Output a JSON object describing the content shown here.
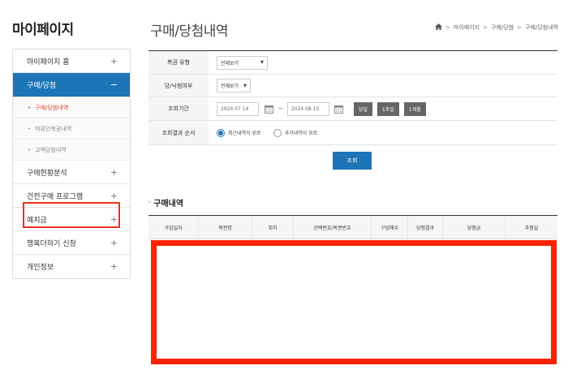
{
  "sidebar": {
    "title": "마이페이지",
    "items": [
      {
        "label": "마이페이지 홈",
        "toggle": "+"
      },
      {
        "label": "구매/당첨",
        "toggle": "−"
      },
      {
        "label": "구매현황분석",
        "toggle": "+"
      },
      {
        "label": "건전구매 프로그램",
        "toggle": "+"
      },
      {
        "label": "예치금",
        "toggle": "+"
      },
      {
        "label": "행복더하기 신청",
        "toggle": "+"
      },
      {
        "label": "개인정보",
        "toggle": "+"
      }
    ],
    "subitems": [
      {
        "label": "구매/당첨내역"
      },
      {
        "label": "미확인복권내역"
      },
      {
        "label": "고액당첨내역"
      }
    ]
  },
  "header": {
    "title": "구매/당첨내역",
    "breadcrumb": [
      "마이페이지",
      "구매/당첨",
      "구매/당첨내역"
    ]
  },
  "form": {
    "rows": {
      "lottery_type": {
        "label": "복권 유형",
        "value": "전체보기"
      },
      "win_status": {
        "label": "당/낙첨여부",
        "value": "전체보기"
      },
      "period": {
        "label": "조회기간",
        "start": "2024 07 14",
        "end": "2024 08 13",
        "tilde": "~",
        "quick": [
          "당일",
          "1주일",
          "1개월"
        ]
      },
      "order": {
        "label": "조회결과 순서",
        "options": [
          "최근내역이 위로",
          "과거내역이 위로"
        ],
        "selected_index": 0
      }
    },
    "search_label": "조회"
  },
  "results": {
    "title": "구매내역",
    "columns": [
      "구입일자",
      "복권명",
      "회차",
      "선택번호/복권번호",
      "구입매수",
      "당첨결과",
      "당첨금",
      "추첨일"
    ]
  },
  "colors": {
    "accent": "#1d74b7",
    "highlight": "#e8321c",
    "redact": "#ff2200"
  },
  "icons": [
    "home-icon",
    "calendar-icon",
    "chevron-down-icon",
    "plus-icon",
    "minus-icon"
  ]
}
